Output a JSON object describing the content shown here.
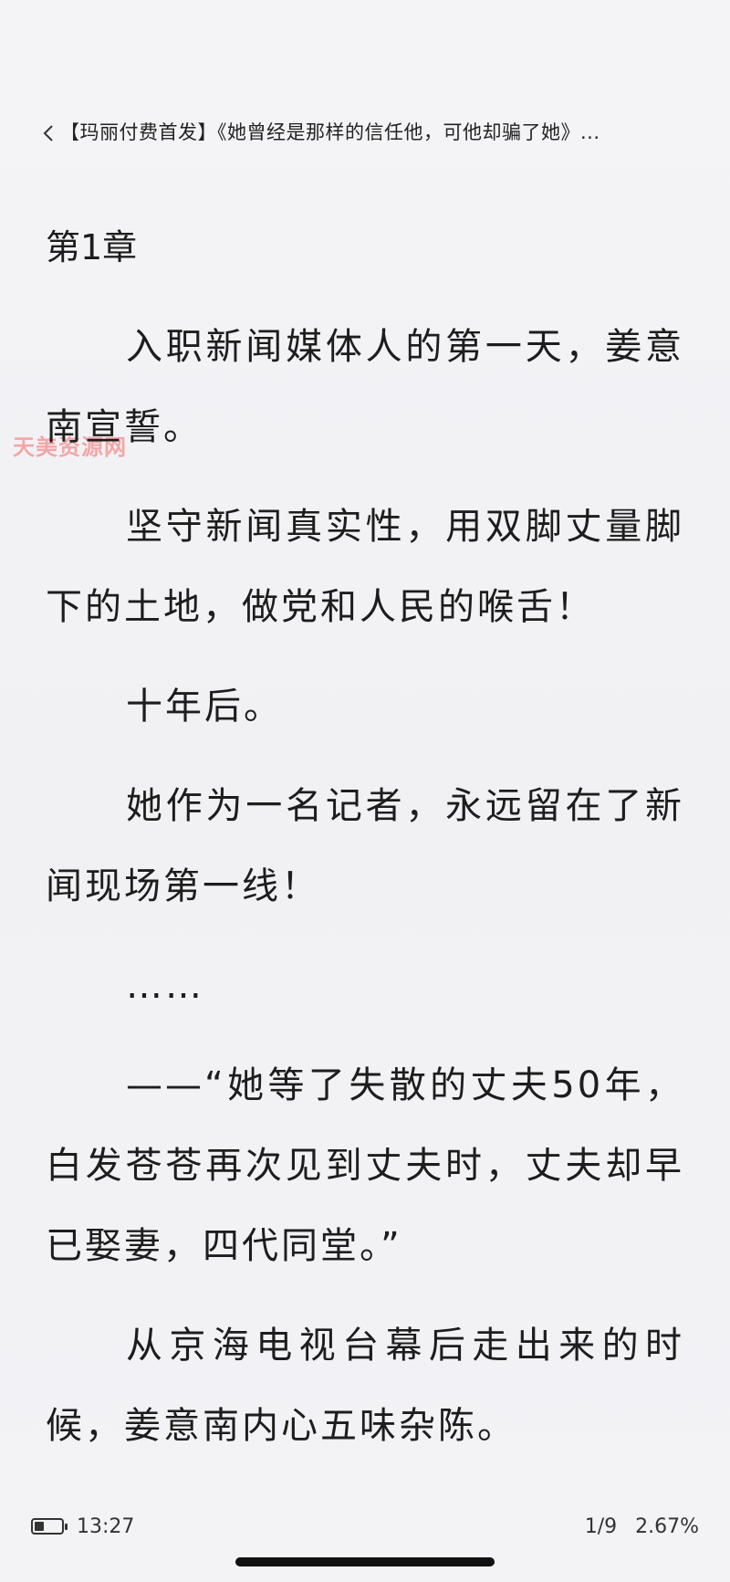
{
  "header": {
    "back_icon": "chevron-left-icon",
    "book_title": "【玛丽付费首发】《她曾经是那样的信任他，可他却骗了她》..."
  },
  "chapter": {
    "title": "第1章"
  },
  "watermark": "天美资源网",
  "paragraphs": [
    "入职新闻媒体人的第一天，姜意南宣誓。",
    "坚守新闻真实性，用双脚丈量脚下的土地，做党和人民的喉舌！",
    "十年后。",
    "她作为一名记者，永远留在了新闻现场第一线！",
    "……",
    "——“她等了失散的丈夫50年，白发苍苍再次见到丈夫时，丈夫却早已娶妻，四代同堂。”",
    "从京海电视台幕后走出来的时候，姜意南内心五味杂陈。"
  ],
  "status": {
    "battery_icon": "battery-icon",
    "battery_level": 0.35,
    "time": "13:27",
    "page": "1/9",
    "progress": "2.67%"
  }
}
